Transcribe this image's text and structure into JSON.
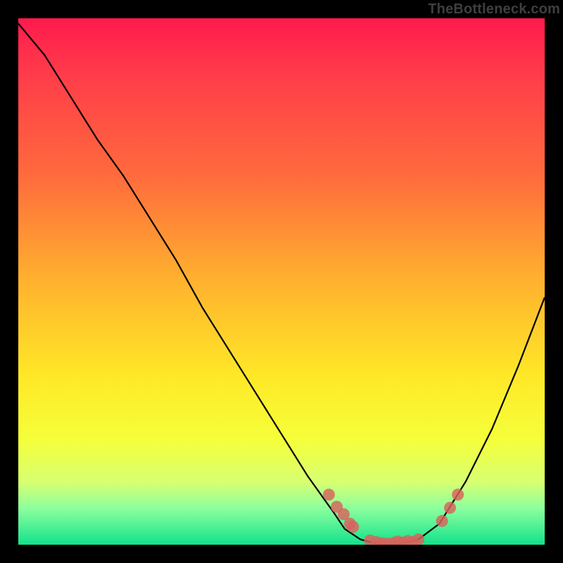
{
  "watermark": "TheBottleneck.com",
  "chart_data": {
    "type": "line",
    "title": "",
    "xlabel": "",
    "ylabel": "",
    "xlim": [
      0,
      100
    ],
    "ylim": [
      0,
      100
    ],
    "grid": false,
    "curve": {
      "x": [
        0,
        5,
        10,
        15,
        20,
        25,
        30,
        35,
        40,
        45,
        50,
        55,
        60,
        62,
        65,
        68,
        70,
        73,
        76,
        80,
        85,
        90,
        95,
        100
      ],
      "y": [
        99,
        93,
        85,
        77,
        70,
        62,
        54,
        45,
        37,
        29,
        21,
        13,
        6,
        3,
        1,
        0.2,
        0,
        0.2,
        1,
        4,
        12,
        22,
        34,
        47
      ]
    },
    "points": {
      "x": [
        59,
        60.5,
        61.8,
        63,
        63.6,
        66.8,
        68,
        69,
        70,
        71.2,
        72,
        73,
        74,
        75,
        76,
        80.5,
        82,
        83.5
      ],
      "y": [
        9.5,
        7.2,
        5.8,
        4.0,
        3.4,
        0.8,
        0.5,
        0.3,
        0.2,
        0.3,
        0.6,
        0.4,
        0.7,
        0.5,
        1.0,
        4.5,
        7.0,
        9.5
      ]
    },
    "gradient_stops": [
      {
        "offset": 0.0,
        "meaning": "worst",
        "color": "#ff1a4d"
      },
      {
        "offset": 0.5,
        "meaning": "mid",
        "color": "#ffb22e"
      },
      {
        "offset": 0.8,
        "meaning": "good",
        "color": "#f5ff3a"
      },
      {
        "offset": 1.0,
        "meaning": "best",
        "color": "#12e28b"
      }
    ]
  }
}
